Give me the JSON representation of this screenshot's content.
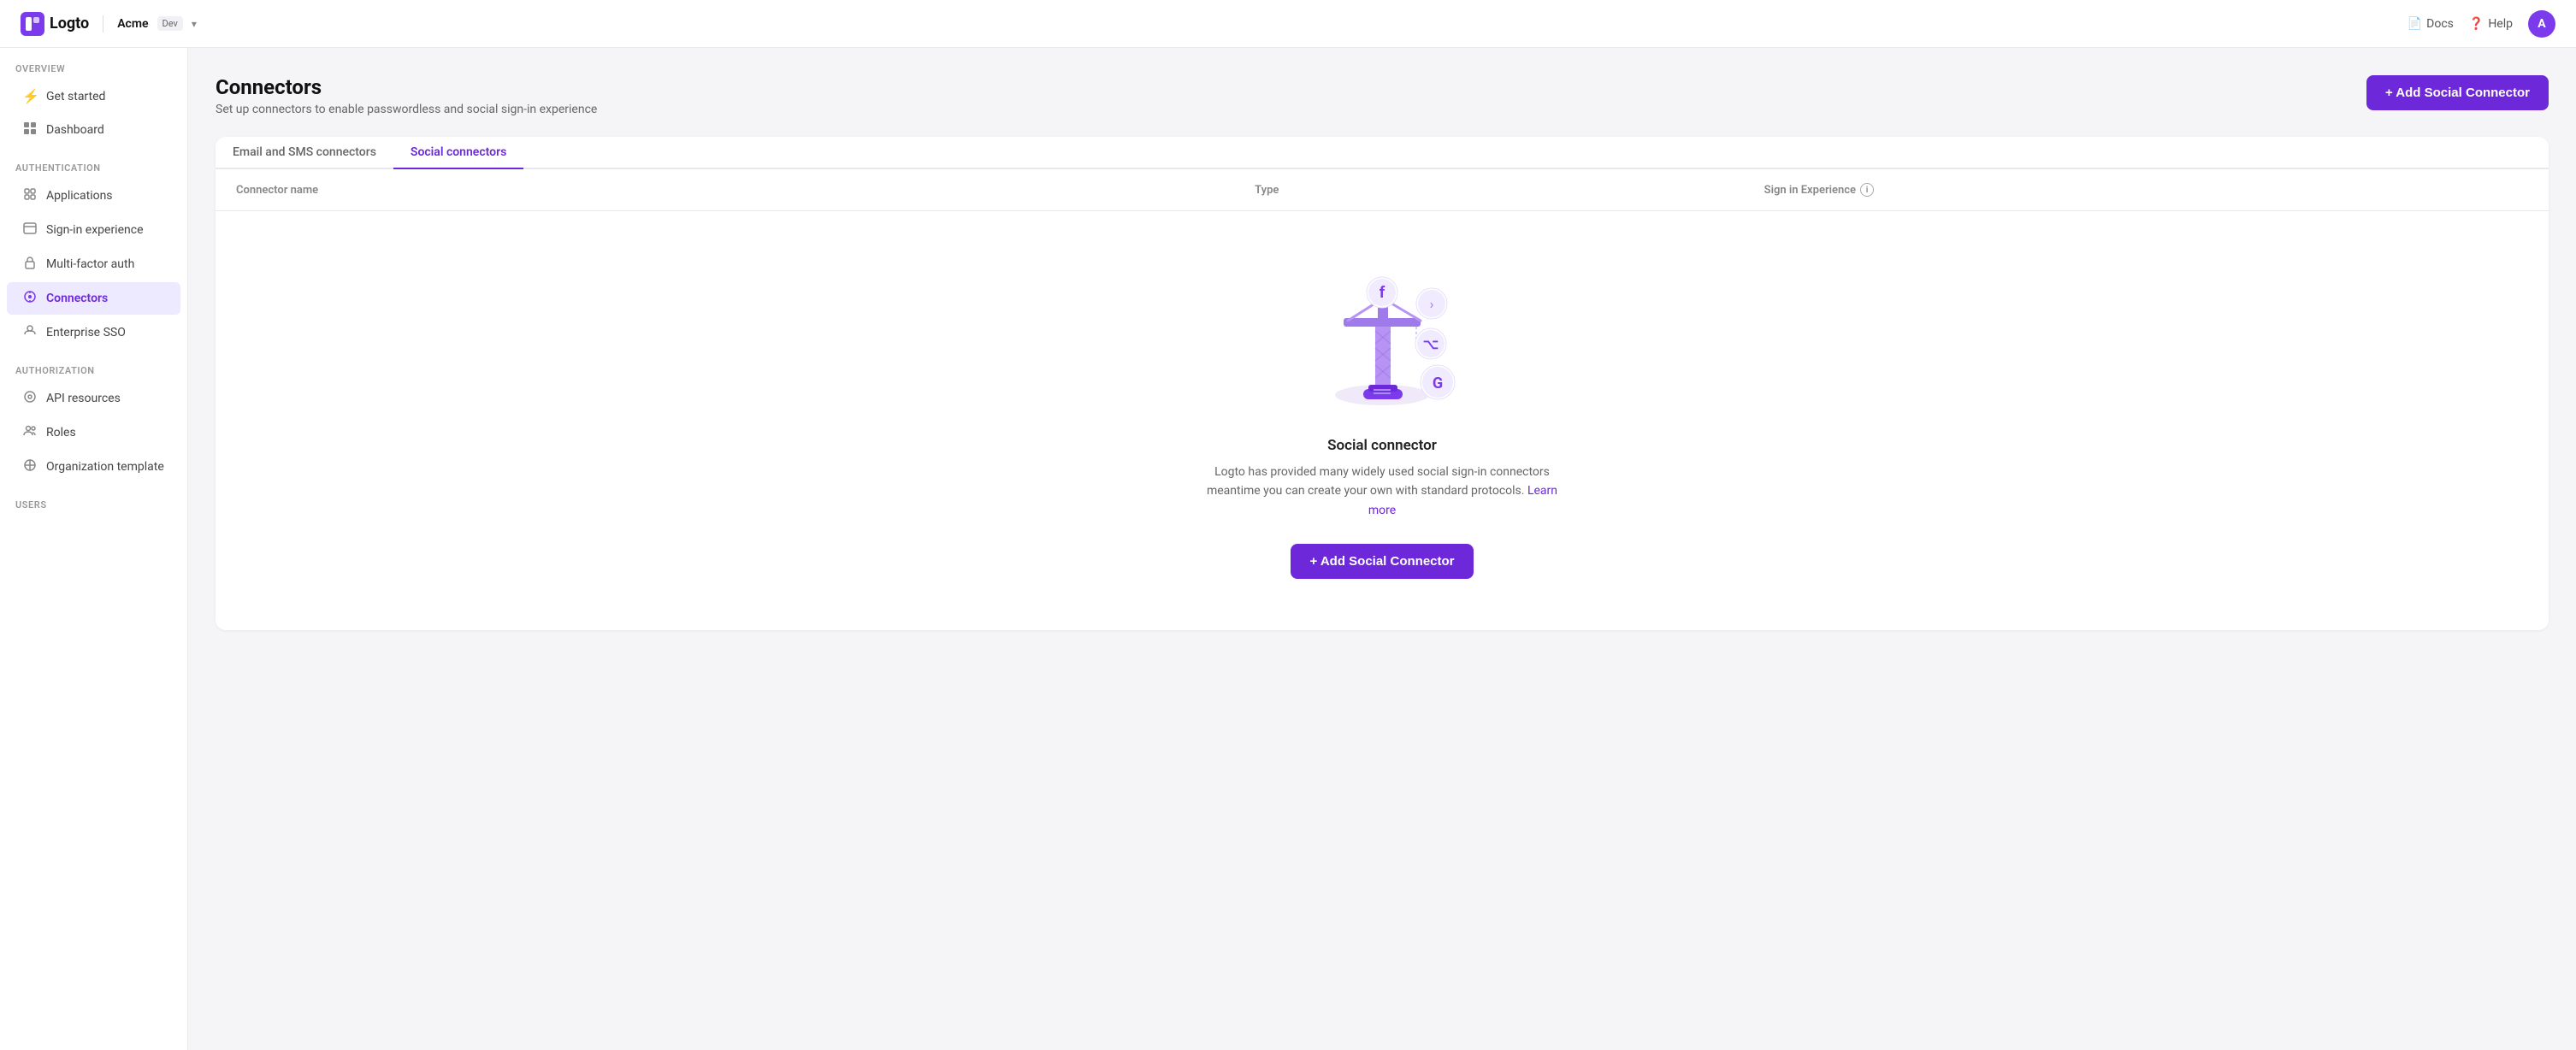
{
  "app": {
    "logo_text": "Logto",
    "tenant_name": "Acme",
    "tenant_env": "Dev"
  },
  "topbar": {
    "docs_label": "Docs",
    "help_label": "Help",
    "avatar_initials": "A"
  },
  "sidebar": {
    "overview_label": "OVERVIEW",
    "authentication_label": "AUTHENTICATION",
    "authorization_label": "AUTHORIZATION",
    "users_label": "USERS",
    "items": [
      {
        "id": "get-started",
        "label": "Get started",
        "icon": "⚡"
      },
      {
        "id": "dashboard",
        "label": "Dashboard",
        "icon": "▦"
      },
      {
        "id": "applications",
        "label": "Applications",
        "icon": "⬡"
      },
      {
        "id": "sign-in-experience",
        "label": "Sign-in experience",
        "icon": "▤"
      },
      {
        "id": "multi-factor-auth",
        "label": "Multi-factor auth",
        "icon": "🔒"
      },
      {
        "id": "connectors",
        "label": "Connectors",
        "icon": "◈",
        "active": true
      },
      {
        "id": "enterprise-sso",
        "label": "Enterprise SSO",
        "icon": "☁"
      },
      {
        "id": "api-resources",
        "label": "API resources",
        "icon": "◎"
      },
      {
        "id": "roles",
        "label": "Roles",
        "icon": "👤"
      },
      {
        "id": "organization-template",
        "label": "Organization template",
        "icon": "⊕"
      }
    ]
  },
  "page": {
    "title": "Connectors",
    "subtitle": "Set up connectors to enable passwordless and social sign-in experience",
    "add_button_label": "+ Add Social Connector"
  },
  "tabs": [
    {
      "id": "email-sms",
      "label": "Email and SMS connectors"
    },
    {
      "id": "social",
      "label": "Social connectors",
      "active": true
    }
  ],
  "table": {
    "columns": [
      {
        "id": "name",
        "label": "Connector name"
      },
      {
        "id": "type",
        "label": "Type"
      },
      {
        "id": "sign-in",
        "label": "Sign in Experience",
        "has_info": true
      }
    ]
  },
  "empty_state": {
    "title": "Social connector",
    "description": "Logto has provided many widely used social sign-in connectors meantime you can create your own with standard protocols.",
    "learn_more_label": "Learn more",
    "add_button_label": "+ Add Social Connector"
  }
}
